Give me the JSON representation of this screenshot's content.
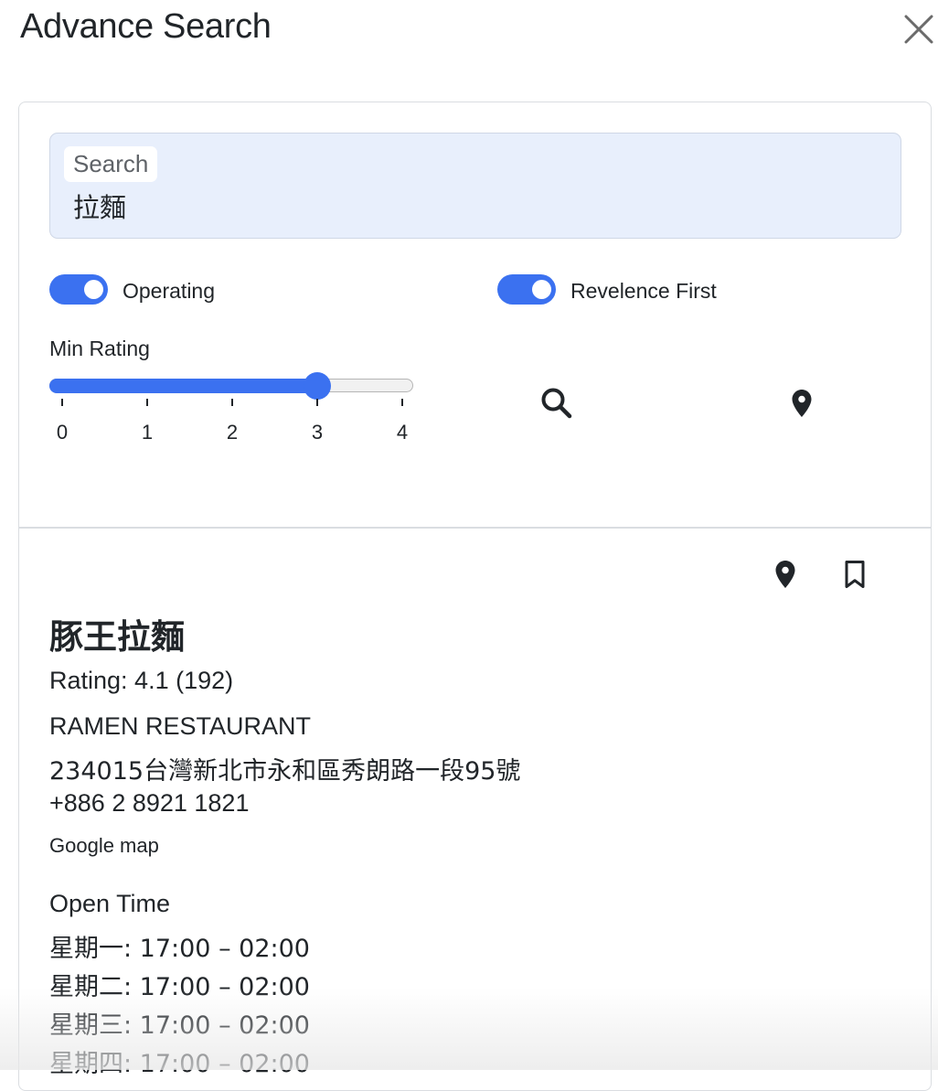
{
  "dialog": {
    "title": "Advance Search"
  },
  "search": {
    "label": "Search",
    "value": "拉麵"
  },
  "filters": {
    "operating": {
      "label": "Operating",
      "enabled": true
    },
    "relevance_first": {
      "label": "Revelence First",
      "enabled": true
    },
    "min_rating": {
      "label": "Min Rating",
      "value": 3,
      "min": 0,
      "max": 4,
      "ticks": [
        "0",
        "1",
        "2",
        "3",
        "4"
      ]
    }
  },
  "actions": {
    "search_icon": "search-icon",
    "location_icon": "location-pin-icon"
  },
  "result": {
    "name": "豚王拉麵",
    "rating": "Rating: 4.1 (192)",
    "category": "RAMEN RESTAURANT",
    "address": "234015台灣新北市永和區秀朗路一段95號",
    "phone": "+886 2 8921 1821",
    "map_link": "Google map",
    "open_time_label": "Open Time",
    "hours": [
      "星期一: 17:00 – 02:00",
      "星期二: 17:00 – 02:00",
      "星期三: 17:00 – 02:00",
      "星期四: 17:00 – 02:00"
    ]
  },
  "colors": {
    "accent": "#3b71f0",
    "search_bg": "#e8effc",
    "text": "#212529",
    "border": "#dadde1"
  }
}
